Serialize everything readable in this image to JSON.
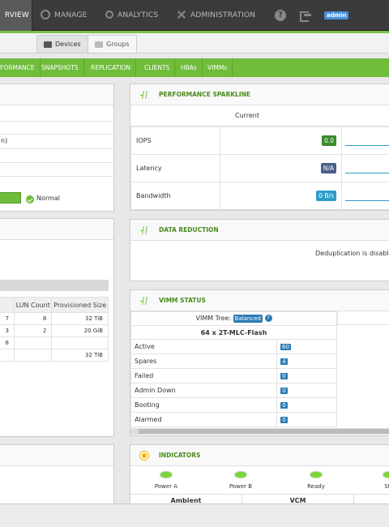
{
  "topnav": {
    "items": [
      {
        "label": "RVIEW"
      },
      {
        "label": "MANAGE",
        "icon": "gear-icon"
      },
      {
        "label": "ANALYTICS",
        "icon": "search-icon"
      },
      {
        "label": "ADMINISTRATION",
        "icon": "wrench-icon"
      }
    ],
    "help": "?",
    "user": "admin"
  },
  "subtabs": [
    {
      "label": "Devices",
      "icon": "device-icon"
    },
    {
      "label": "Groups",
      "icon": "groups-icon"
    }
  ],
  "menu": [
    "FORMANCE",
    "SNAPSHOTS",
    "REPLICATION",
    "CLIENTS",
    "HBAs",
    "VIMMs"
  ],
  "left_info": {
    "row_text": "n)",
    "status": "Normal"
  },
  "lun_table": {
    "headers": [
      "LUN Count",
      "Provisioned Size"
    ],
    "rows": [
      {
        "c0": "7",
        "c1": "8",
        "c2": "32 TiB"
      },
      {
        "c0": "3",
        "c1": "2",
        "c2": "20 GiB"
      },
      {
        "c0": "8",
        "c1": "",
        "c2": ""
      },
      {
        "c0": "",
        "c1": "",
        "c2": "32 TiB"
      }
    ]
  },
  "perf": {
    "title": "PERFORMANCE SPARKLINE",
    "col_header": "Current",
    "rows": [
      {
        "label": "IOPS",
        "value": "0.0",
        "color": "#3b8a2e"
      },
      {
        "label": "Latency",
        "value": "N/A",
        "color": "#4a5f8a"
      },
      {
        "label": "Bandwidth",
        "value": "0 B/s",
        "color": "#2e9bc9"
      }
    ]
  },
  "data_reduction": {
    "title": "DATA REDUCTION",
    "text": "Deduplication is disable"
  },
  "vimm": {
    "title": "VIMM STATUS",
    "tree_label": "VIMM Tree:",
    "tree_state": "Balanced",
    "config": "64 x 2T-MLC-Flash",
    "rows": [
      {
        "label": "Active",
        "value": "60"
      },
      {
        "label": "Spares",
        "value": "4"
      },
      {
        "label": "Failed",
        "value": "0"
      },
      {
        "label": "Admin Down",
        "value": "0"
      },
      {
        "label": "Booting",
        "value": "0"
      },
      {
        "label": "Alarmed",
        "value": "0"
      }
    ]
  },
  "indicators": {
    "title": "INDICATORS",
    "leds": [
      "Power A",
      "Power B",
      "Ready",
      "Sta"
    ],
    "sensors": [
      "Ambient",
      "VCM"
    ]
  }
}
